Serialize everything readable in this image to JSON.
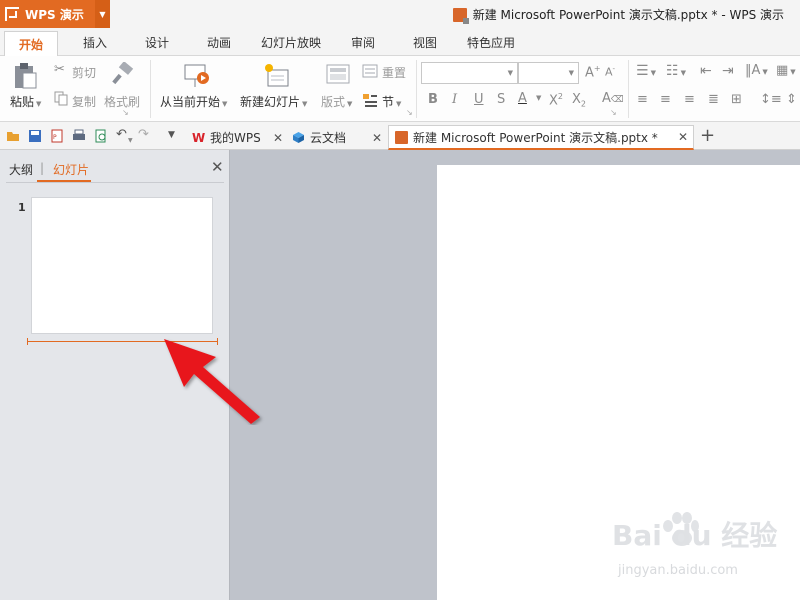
{
  "app": {
    "name": "WPS 演示"
  },
  "window": {
    "title": "新建 Microsoft PowerPoint 演示文稿.pptx * - WPS 演示"
  },
  "ribbon_tabs": [
    "开始",
    "插入",
    "设计",
    "动画",
    "幻灯片放映",
    "审阅",
    "视图",
    "特色应用"
  ],
  "ribbon": {
    "paste": "粘贴",
    "cut": "剪切",
    "copy": "复制",
    "format_painter": "格式刷",
    "from_current": "从当前开始",
    "new_slide": "新建幻灯片",
    "layout": "版式",
    "reset": "重置",
    "section": "节",
    "font_name": "",
    "font_size": ""
  },
  "doc_tabs": [
    {
      "label": "我的WPS"
    },
    {
      "label": "云文档"
    },
    {
      "label": "新建 Microsoft PowerPoint 演示文稿.pptx *"
    }
  ],
  "left_pane": {
    "tab_outline": "大纲",
    "tab_slides": "幻灯片",
    "slide_number": "1"
  },
  "watermark": {
    "text": "Bai du 经验",
    "sub": "jingyan.baidu.com"
  },
  "colors": {
    "accent": "#e26a22",
    "arrow": "#e8151b",
    "workspace": "#bfc3cb"
  }
}
